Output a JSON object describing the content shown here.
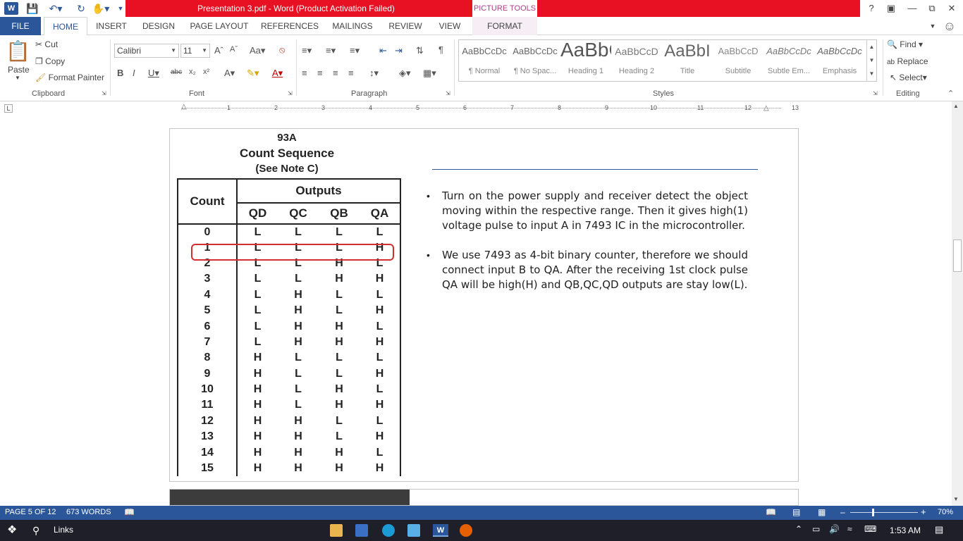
{
  "window": {
    "title": "Presentation 3.pdf -  Word (Product Activation Failed)",
    "context_tab_group": "PICTURE TOOLS",
    "help_btn": "?",
    "accent": "#2b579a",
    "title_band_color": "#e81123"
  },
  "tabs": [
    "FILE",
    "HOME",
    "INSERT",
    "DESIGN",
    "PAGE LAYOUT",
    "REFERENCES",
    "MAILINGS",
    "REVIEW",
    "VIEW",
    "FORMAT"
  ],
  "clipboard": {
    "paste": "Paste",
    "cut": "Cut",
    "copy": "Copy",
    "format_painter": "Format Painter",
    "label": "Clipboard"
  },
  "font": {
    "name": "Calibri",
    "size": "11",
    "label": "Font"
  },
  "paragraph": {
    "label": "Paragraph"
  },
  "styles": {
    "label": "Styles",
    "items": [
      {
        "preview": "AaBbCcDc",
        "name": "¶ Normal"
      },
      {
        "preview": "AaBbCcDc",
        "name": "¶ No Spac..."
      },
      {
        "preview": "AaBbCc",
        "name": "Heading 1"
      },
      {
        "preview": "AaBbCcD",
        "name": "Heading 2"
      },
      {
        "preview": "AaBbI",
        "name": "Title"
      },
      {
        "preview": "AaBbCcD",
        "name": "Subtitle"
      },
      {
        "preview": "AaBbCcDc",
        "name": "Subtle Em..."
      },
      {
        "preview": "AaBbCcDc",
        "name": "Emphasis"
      }
    ]
  },
  "editing": {
    "find": "Find",
    "replace": "Replace",
    "select": "Select",
    "label": "Editing"
  },
  "ruler": {
    "numbers": [
      "1",
      "2",
      "3",
      "4",
      "5",
      "6",
      "7",
      "8",
      "9",
      "10",
      "11",
      "12",
      "13"
    ]
  },
  "figure": {
    "title1": "93A",
    "title2": "Count Sequence",
    "title3": "(See Note C)",
    "count_header": "Count",
    "outputs_header": "Outputs",
    "cols": [
      "QD",
      "QC",
      "QB",
      "QA"
    ],
    "rows": [
      [
        "0",
        "L",
        "L",
        "L",
        "L"
      ],
      [
        "1",
        "L",
        "L",
        "L",
        "H"
      ],
      [
        "2",
        "L",
        "L",
        "H",
        "L"
      ],
      [
        "3",
        "L",
        "L",
        "H",
        "H"
      ],
      [
        "4",
        "L",
        "H",
        "L",
        "L"
      ],
      [
        "5",
        "L",
        "H",
        "L",
        "H"
      ],
      [
        "6",
        "L",
        "H",
        "H",
        "L"
      ],
      [
        "7",
        "L",
        "H",
        "H",
        "H"
      ],
      [
        "8",
        "H",
        "L",
        "L",
        "L"
      ],
      [
        "9",
        "H",
        "L",
        "L",
        "H"
      ],
      [
        "10",
        "H",
        "L",
        "H",
        "L"
      ],
      [
        "11",
        "H",
        "L",
        "H",
        "H"
      ],
      [
        "12",
        "H",
        "H",
        "L",
        "L"
      ],
      [
        "13",
        "H",
        "H",
        "L",
        "H"
      ],
      [
        "14",
        "H",
        "H",
        "H",
        "L"
      ],
      [
        "15",
        "H",
        "H",
        "H",
        "H"
      ]
    ],
    "highlight_row": 1
  },
  "body": {
    "p1": "Turn on the power supply and receiver detect the object moving within the respective range. Then it gives high(1) voltage pulse to input A in 7493 IC in the microcontroller.",
    "p2": "We use 7493 as 4-bit binary counter, therefore we should connect input B to QA. After the receiving 1st clock pulse QA will be high(H) and QB,QC,QD outputs are stay low(L)."
  },
  "status": {
    "page": "PAGE 5 OF 12",
    "words": "673 WORDS",
    "zoom": "70%"
  },
  "taskbar": {
    "search": "Links",
    "time": "1:53 AM"
  }
}
